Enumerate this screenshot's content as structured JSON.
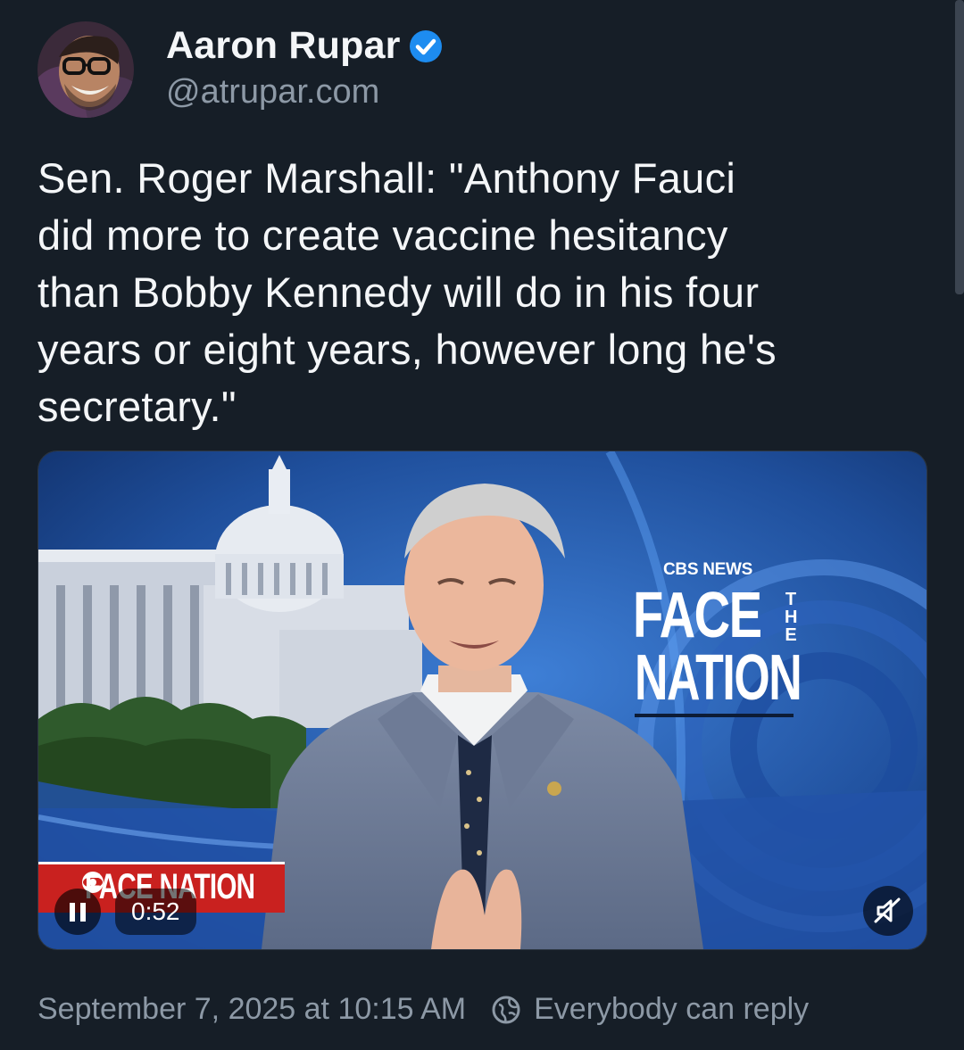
{
  "author": {
    "display_name": "Aaron Rupar",
    "handle": "@atrupar.com",
    "verified_icon": "verified-check-icon",
    "avatar_icon": "avatar-photo"
  },
  "post": {
    "text": "Sen. Roger Marshall: \"Anthony Fauci\ndid more to create vaccine hesitancy\nthan Bobby Kennedy will do in his four\nyears or eight years, however long he's\nsecretary.\""
  },
  "video": {
    "network": "CBS NEWS",
    "show_face": "FACE",
    "show_the": "THE",
    "show_nation": "NATION",
    "lower_third": "FACE NATION",
    "time": "0:52",
    "pause_icon": "pause-icon",
    "mute_icon": "muted-speaker-icon"
  },
  "footer": {
    "timestamp": "September 7, 2025 at 10:15 AM",
    "reply_setting": "Everybody can reply",
    "reply_icon": "globe-icon"
  },
  "colors": {
    "background": "#161e27",
    "text_primary": "#f4f6f8",
    "text_secondary": "#8d99a6",
    "verified": "#1d8cf0",
    "broadcast_red": "#c9211f",
    "broadcast_blue": "#2b62b8"
  }
}
